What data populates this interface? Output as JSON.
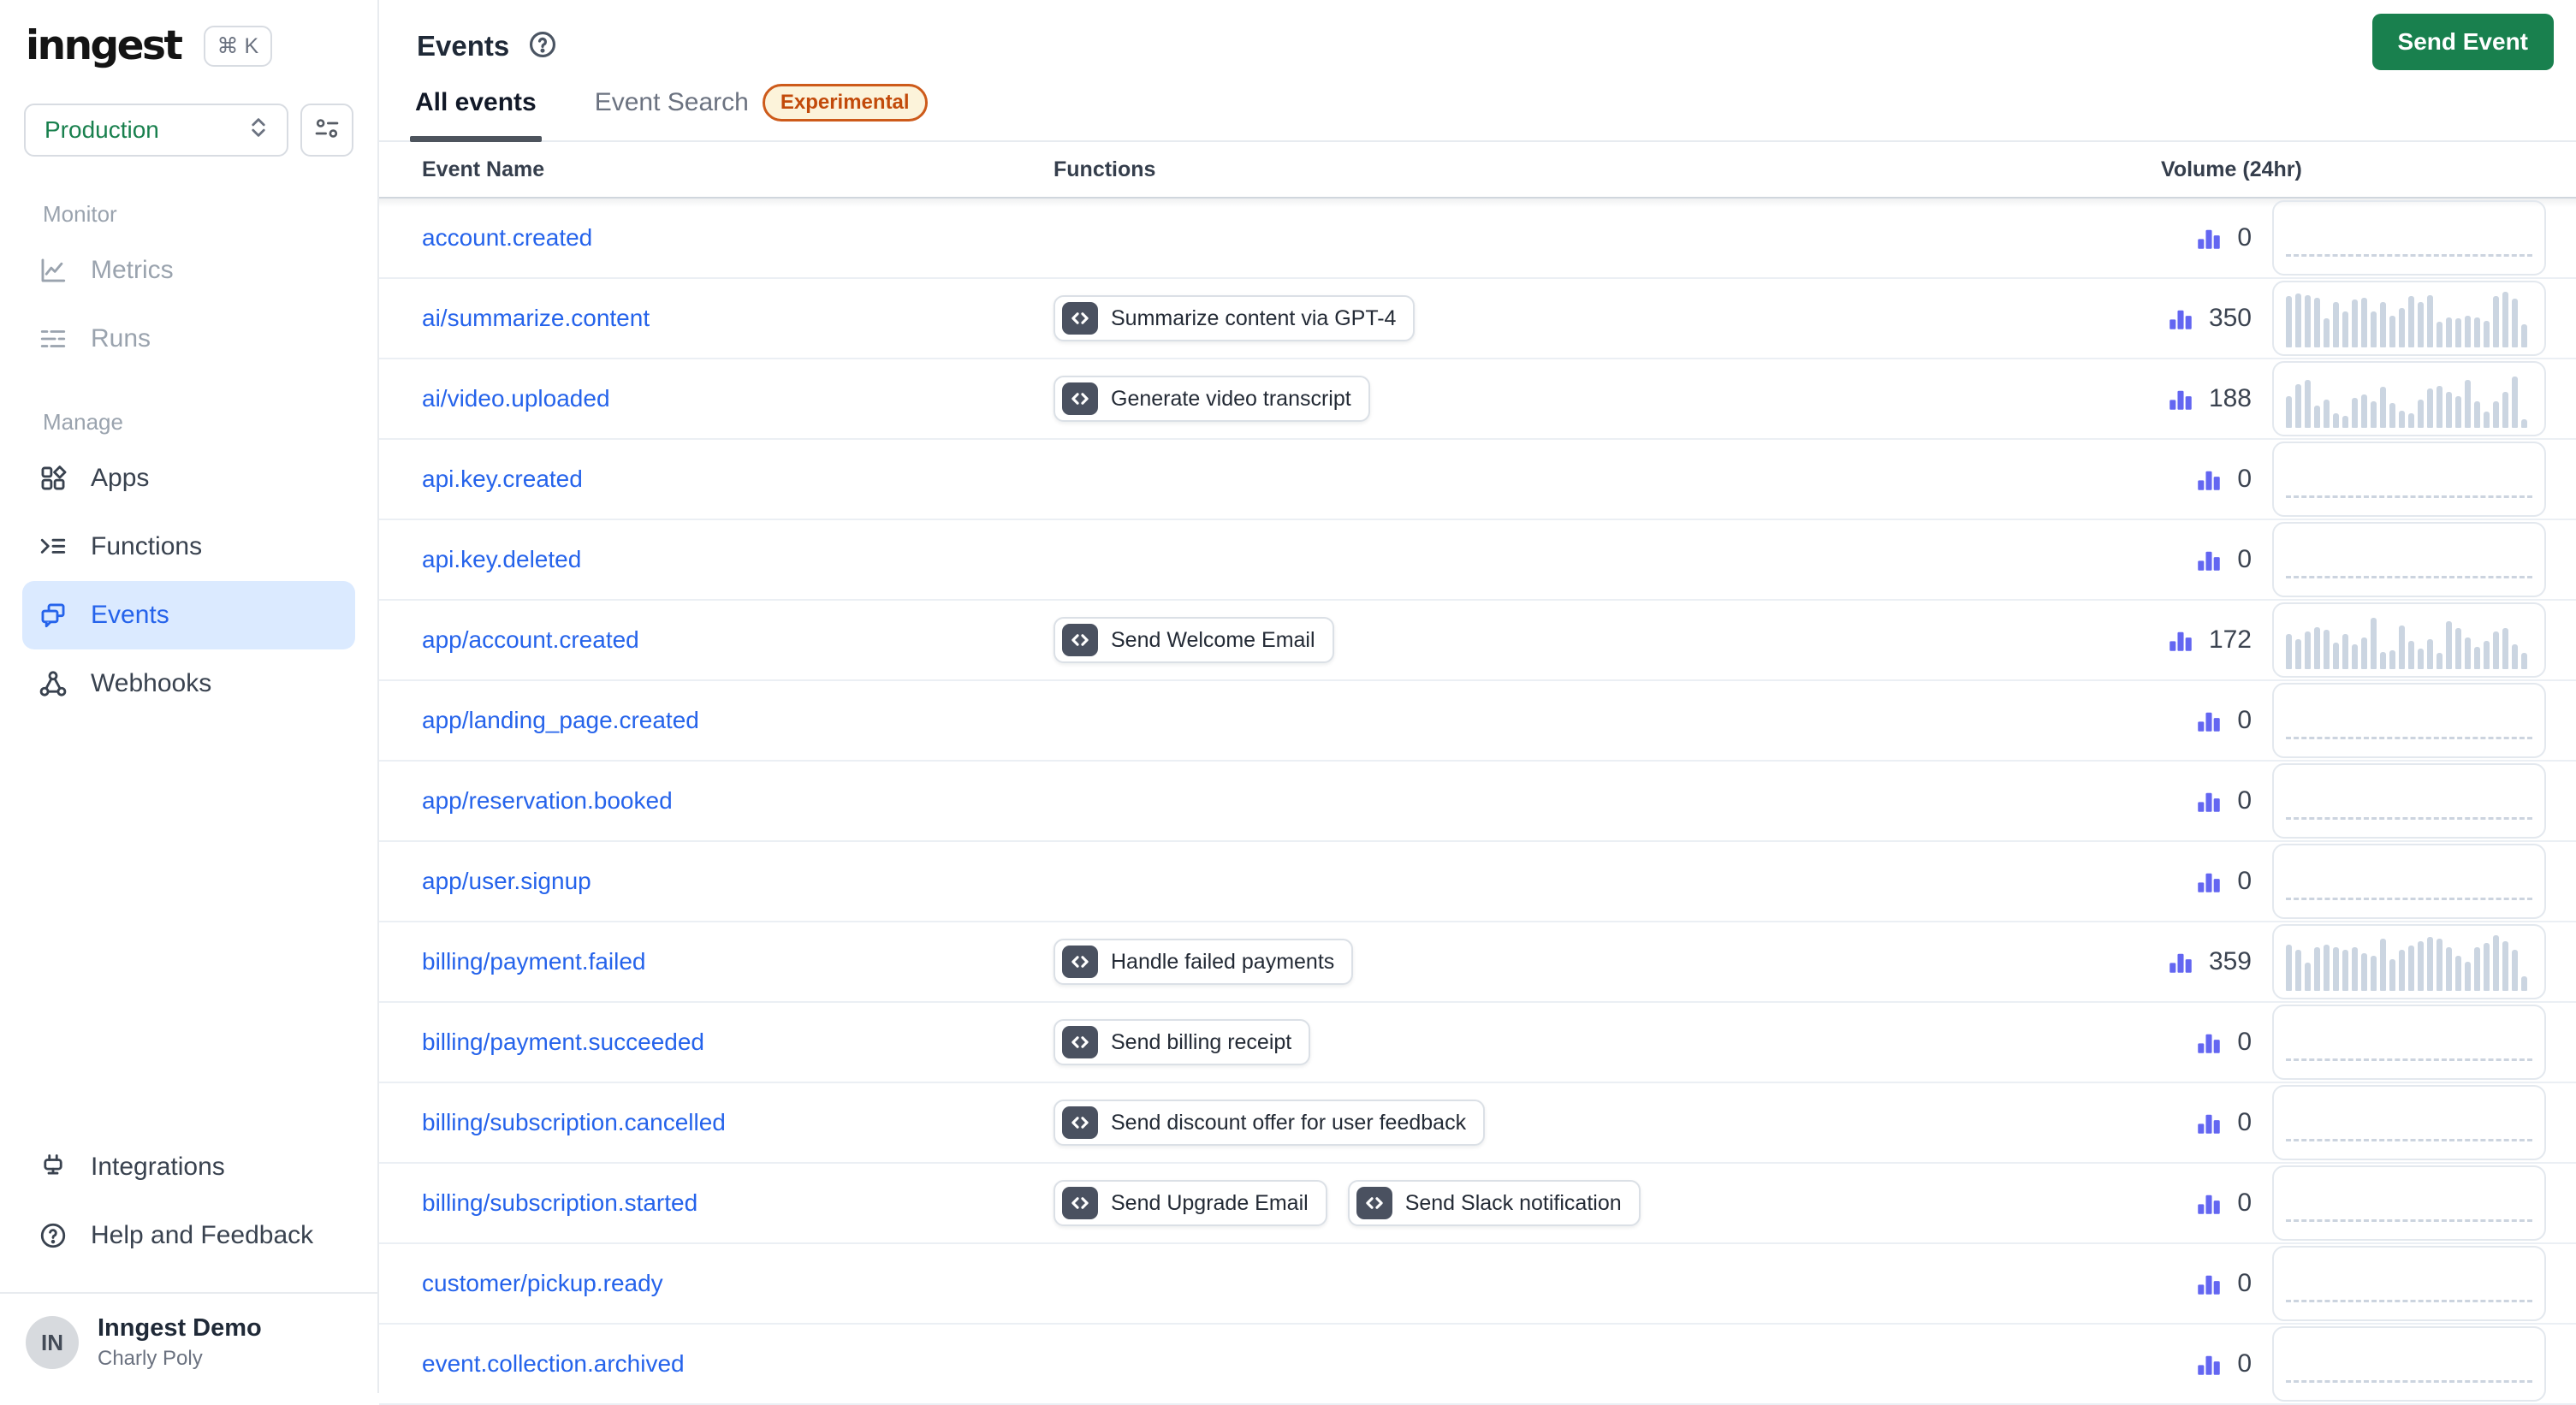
{
  "app": {
    "logo": "inngest",
    "shortcut": "⌘ K"
  },
  "colors": {
    "accent_green": "#19804E",
    "link_blue": "#2563EB",
    "volume_indigo": "#6366F1",
    "experimental_orange": "#C24A0A",
    "spark_bar": "#CBD5E1"
  },
  "sidebar": {
    "environment": {
      "value": "Production"
    },
    "sections": [
      {
        "label": "Monitor",
        "items": [
          {
            "label": "Metrics"
          },
          {
            "label": "Runs"
          }
        ]
      },
      {
        "label": "Manage",
        "items": [
          {
            "label": "Apps"
          },
          {
            "label": "Functions"
          },
          {
            "label": "Events"
          },
          {
            "label": "Webhooks"
          }
        ]
      }
    ],
    "footer_items": [
      {
        "label": "Integrations"
      },
      {
        "label": "Help and Feedback"
      }
    ],
    "user": {
      "initials": "IN",
      "org": "Inngest Demo",
      "name": "Charly Poly"
    }
  },
  "header": {
    "title": "Events",
    "send_button": "Send Event"
  },
  "tabs": [
    {
      "label": "All events",
      "active": true
    },
    {
      "label": "Event Search",
      "badge": "Experimental"
    }
  ],
  "table": {
    "columns": {
      "name": "Event Name",
      "functions": "Functions",
      "volume": "Volume (24hr)"
    },
    "rows": [
      {
        "name": "account.created",
        "functions": [],
        "volume": 0,
        "bars": []
      },
      {
        "name": "ai/summarize.content",
        "functions": [
          "Summarize content via GPT-4"
        ],
        "volume": 350,
        "bars": [
          88,
          92,
          90,
          86,
          50,
          78,
          62,
          82,
          85,
          62,
          78,
          55,
          68,
          88,
          78,
          90,
          44,
          52,
          50,
          55,
          52,
          46,
          88,
          95,
          84,
          40
        ]
      },
      {
        "name": "ai/video.uploaded",
        "functions": [
          "Generate video transcript"
        ],
        "volume": 188,
        "bars": [
          55,
          75,
          82,
          38,
          48,
          25,
          20,
          52,
          58,
          45,
          70,
          42,
          30,
          25,
          48,
          68,
          72,
          62,
          55,
          82,
          45,
          28,
          45,
          62,
          88,
          15
        ]
      },
      {
        "name": "api.key.created",
        "functions": [],
        "volume": 0,
        "bars": []
      },
      {
        "name": "api.key.deleted",
        "functions": [],
        "volume": 0,
        "bars": []
      },
      {
        "name": "app/account.created",
        "functions": [
          "Send Welcome Email"
        ],
        "volume": 172,
        "bars": [
          60,
          52,
          65,
          72,
          68,
          45,
          60,
          42,
          55,
          88,
          30,
          32,
          75,
          48,
          35,
          52,
          28,
          82,
          70,
          55,
          38,
          48,
          65,
          70,
          42,
          28
        ]
      },
      {
        "name": "app/landing_page.created",
        "functions": [],
        "volume": 0,
        "bars": []
      },
      {
        "name": "app/reservation.booked",
        "functions": [],
        "volume": 0,
        "bars": []
      },
      {
        "name": "app/user.signup",
        "functions": [],
        "volume": 0,
        "bars": []
      },
      {
        "name": "billing/payment.failed",
        "functions": [
          "Handle failed payments"
        ],
        "volume": 359,
        "bars": [
          80,
          70,
          48,
          75,
          80,
          75,
          70,
          75,
          65,
          60,
          90,
          55,
          70,
          78,
          85,
          92,
          90,
          75,
          60,
          50,
          75,
          82,
          95,
          85,
          70,
          25
        ]
      },
      {
        "name": "billing/payment.succeeded",
        "functions": [
          "Send billing receipt"
        ],
        "volume": 0,
        "bars": []
      },
      {
        "name": "billing/subscription.cancelled",
        "functions": [
          "Send discount offer for user feedback"
        ],
        "volume": 0,
        "bars": []
      },
      {
        "name": "billing/subscription.started",
        "functions": [
          "Send Upgrade Email",
          "Send Slack notification"
        ],
        "volume": 0,
        "bars": []
      },
      {
        "name": "customer/pickup.ready",
        "functions": [],
        "volume": 0,
        "bars": []
      },
      {
        "name": "event.collection.archived",
        "functions": [],
        "volume": 0,
        "bars": []
      }
    ]
  }
}
